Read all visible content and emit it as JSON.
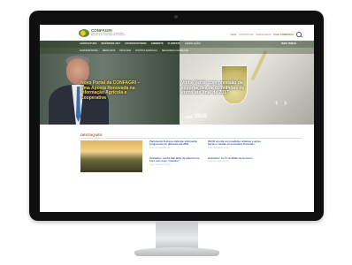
{
  "site": {
    "logo_name": "CONFAGRI",
    "logo_sub": "Confederação Nacional das Cooperativas Agrícolas e do Crédito Agrícola de Portugal"
  },
  "header": {
    "links": [
      "SEDE",
      "CONTACTOS",
      "ASSOCIADOS"
    ],
    "highlight": "FALE CONNOSCO"
  },
  "menu": {
    "items": [
      "AGRICULTURA",
      "INCÊNDIOS 2017",
      "COOPERATIVISMO",
      "AMBIENTE",
      "FLORESTA",
      "LEGISLAÇÃO"
    ],
    "temas": "MAIS TEMAS"
  },
  "submenu": {
    "items": [
      "AGROINDÚSTRIA",
      "MERCADOS",
      "PECUÁRIA",
      "POLÍTICA AGRÍCOLA",
      "SEGURANÇA ALIMENTAR"
    ]
  },
  "hero": {
    "slide1_title": "Novo Portal da CONFAGRI – Uma Aposta Renovada na Informação Agrícola e Cooperativa",
    "slide2_title": "Vinho Verde com previsão de exportações de 80 milhões de euros até final de 2017",
    "prev": "‹",
    "next": "›",
    "badge_a": "PDR",
    "badge_b": "2020"
  },
  "destaques": {
    "title": "DESTAQUES",
    "items": [
      {
        "title": "Parlamento Europeu defende eliminação progressiva do glifosato até 2022",
        "date": "20 DE OUTUBRO DE 2017"
      },
      {
        "title": "OGCE acorda com medidas relativas a ações fiscais e multas em incêndios florestais",
        "date": "20 DE OUTUBRO DE 2017"
      },
      {
        "title": "Incêndios: Lautré São Brás de Alportel em Foro com novo \"máximo\"",
        "date": "20 DE OUTUBRO DE 2017"
      },
      {
        "title": "Incêndios: As 11 medidas do Governo",
        "date": "20 DE OUTUBRO DE 2017"
      }
    ]
  }
}
